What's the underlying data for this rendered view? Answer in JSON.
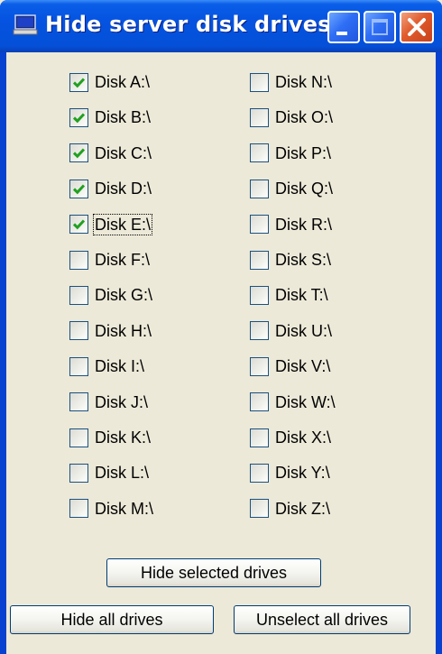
{
  "window": {
    "title": "Hide server disk drives",
    "title_icon": "monitor-app-icon",
    "controls": [
      "minimize-icon",
      "maximize-icon",
      "close-icon"
    ]
  },
  "drives_left": [
    {
      "label": "Disk A:\\",
      "checked": true
    },
    {
      "label": "Disk B:\\",
      "checked": true
    },
    {
      "label": "Disk C:\\",
      "checked": true
    },
    {
      "label": "Disk D:\\",
      "checked": true
    },
    {
      "label": "Disk E:\\",
      "checked": true,
      "focused": true
    },
    {
      "label": "Disk F:\\",
      "checked": false
    },
    {
      "label": "Disk G:\\",
      "checked": false
    },
    {
      "label": "Disk H:\\",
      "checked": false
    },
    {
      "label": "Disk I:\\",
      "checked": false
    },
    {
      "label": "Disk J:\\",
      "checked": false
    },
    {
      "label": "Disk K:\\",
      "checked": false
    },
    {
      "label": "Disk L:\\",
      "checked": false
    },
    {
      "label": "Disk M:\\",
      "checked": false
    }
  ],
  "drives_right": [
    {
      "label": "Disk N:\\",
      "checked": false
    },
    {
      "label": "Disk O:\\",
      "checked": false
    },
    {
      "label": "Disk P:\\",
      "checked": false
    },
    {
      "label": "Disk Q:\\",
      "checked": false
    },
    {
      "label": "Disk R:\\",
      "checked": false
    },
    {
      "label": "Disk S:\\",
      "checked": false
    },
    {
      "label": "Disk T:\\",
      "checked": false
    },
    {
      "label": "Disk U:\\",
      "checked": false
    },
    {
      "label": "Disk V:\\",
      "checked": false
    },
    {
      "label": "Disk W:\\",
      "checked": false
    },
    {
      "label": "Disk X:\\",
      "checked": false
    },
    {
      "label": "Disk Y:\\",
      "checked": false
    },
    {
      "label": "Disk Z:\\",
      "checked": false
    }
  ],
  "buttons": {
    "hide_selected": "Hide selected drives",
    "hide_all": "Hide all drives",
    "unselect_all": "Unselect all drives"
  },
  "colors": {
    "titlebar": "#0553e0",
    "checkmark": "#21a121",
    "dialog_bg": "#ece9d8"
  }
}
